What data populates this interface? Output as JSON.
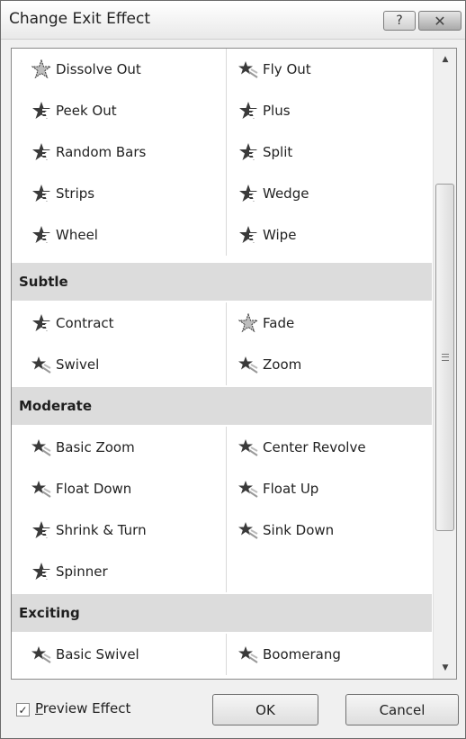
{
  "dialog": {
    "title": "Change Exit Effect",
    "help_label": "?",
    "close_label": "✕"
  },
  "list": {
    "top_rows": [
      {
        "left": {
          "label": "Dissolve Out",
          "icon": "dissolve-star-icon"
        },
        "right": {
          "label": "Fly Out",
          "icon": "fly-star-icon"
        }
      },
      {
        "left": {
          "label": "Peek Out",
          "icon": "peek-star-icon"
        },
        "right": {
          "label": "Plus",
          "icon": "plus-star-icon"
        }
      },
      {
        "left": {
          "label": "Random Bars",
          "icon": "random-bars-star-icon"
        },
        "right": {
          "label": "Split",
          "icon": "split-star-icon"
        }
      },
      {
        "left": {
          "label": "Strips",
          "icon": "strips-star-icon"
        },
        "right": {
          "label": "Wedge",
          "icon": "wedge-star-icon"
        }
      },
      {
        "left": {
          "label": "Wheel",
          "icon": "wheel-star-icon"
        },
        "right": {
          "label": "Wipe",
          "icon": "wipe-star-icon"
        }
      }
    ],
    "subtle": {
      "header": "Subtle",
      "rows": [
        {
          "left": {
            "label": "Contract"
          },
          "right": {
            "label": "Fade"
          }
        },
        {
          "left": {
            "label": "Swivel"
          },
          "right": {
            "label": "Zoom"
          }
        }
      ]
    },
    "moderate": {
      "header": "Moderate",
      "rows": [
        {
          "left": {
            "label": "Basic Zoom"
          },
          "right": {
            "label": "Center Revolve"
          }
        },
        {
          "left": {
            "label": "Float Down"
          },
          "right": {
            "label": "Float Up"
          }
        },
        {
          "left": {
            "label": "Shrink & Turn"
          },
          "right": {
            "label": "Sink Down"
          }
        },
        {
          "left": {
            "label": "Spinner"
          },
          "right": {
            "label": ""
          }
        }
      ]
    },
    "exciting": {
      "header": "Exciting",
      "rows": [
        {
          "left": {
            "label": "Basic Swivel"
          },
          "right": {
            "label": "Boomerang"
          }
        }
      ]
    }
  },
  "scrollbar": {
    "up_label": "▲",
    "down_label": "▼",
    "scroll_position": 0.45
  },
  "footer": {
    "preview_label_first": "P",
    "preview_label_rest": "review Effect",
    "preview_checked": true,
    "check_mark": "✓",
    "ok_label": "OK",
    "cancel_label": "Cancel"
  }
}
